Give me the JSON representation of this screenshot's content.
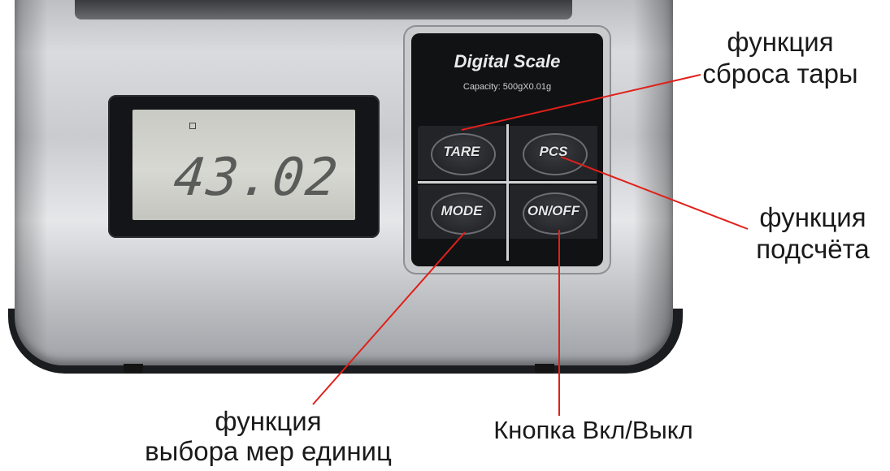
{
  "scale": {
    "brand": "Digital Scale",
    "capacity": "Capacity: 500gX0.01g",
    "display_reading": "43.02",
    "buttons": {
      "tare": "TARE",
      "pcs": "PCS",
      "mode": "MODE",
      "onoff": "ON/OFF"
    }
  },
  "callouts": {
    "tare_line1": "функция",
    "tare_line2": "сброса тары",
    "pcs_line1": "функция",
    "pcs_line2": "подсчёта",
    "mode_line1": "функция",
    "mode_line2": "выбора мер единиц",
    "onoff": "Кнопка Вкл/Выкл"
  },
  "colors": {
    "callout_line": "#e0201a",
    "keypad_bg": "#111214",
    "lcd_bg": "#d2d3cd"
  }
}
